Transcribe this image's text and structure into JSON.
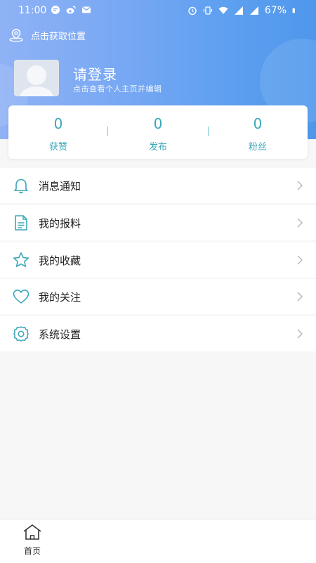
{
  "status_bar": {
    "time": "11:00",
    "battery": "67%"
  },
  "header": {
    "location_text": "点击获取位置",
    "login_title": "请登录",
    "login_subtitle": "点击查看个人主页并编辑"
  },
  "stats": [
    {
      "value": "0",
      "label": "获赞"
    },
    {
      "value": "0",
      "label": "发布"
    },
    {
      "value": "0",
      "label": "粉丝"
    }
  ],
  "menu": [
    {
      "label": "消息通知",
      "icon": "bell-icon"
    },
    {
      "label": "我的报料",
      "icon": "document-icon"
    },
    {
      "label": "我的收藏",
      "icon": "star-icon"
    },
    {
      "label": "我的关注",
      "icon": "heart-icon"
    },
    {
      "label": "系统设置",
      "icon": "gear-icon"
    }
  ],
  "bottom_nav": {
    "home_label": "首页"
  },
  "colors": {
    "accent": "#3aa7b8",
    "header_start": "#8fb2f5",
    "header_end": "#4f97ec"
  }
}
